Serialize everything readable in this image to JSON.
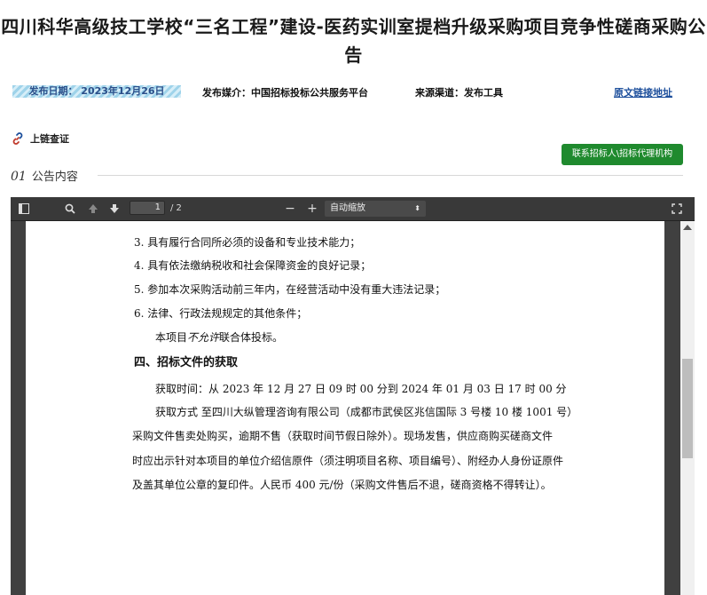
{
  "header": {
    "title": "四川科华高级技工学校“三名工程”建设-医药实训室提档升级采购项目竞争性磋商采购公告"
  },
  "meta": {
    "publish_date": "发布日期：  2023年12月26日",
    "publish_media": "发布媒介：中国招标投标公共服务平台",
    "source_channel": "来源渠道：发布工具",
    "original_link": "原文链接地址"
  },
  "chain_check": {
    "label": "上链查证",
    "icon": "chain-link-icon"
  },
  "contact_button": "联系招标人\\招标代理机构",
  "section": {
    "number": "01",
    "title": "公告内容"
  },
  "viewer": {
    "page_current": "1",
    "page_total": "/ 2",
    "zoom_minus": "−",
    "zoom_plus": "+",
    "zoom_label": "自动缩放",
    "zoom_arrow": "⬍",
    "icons": [
      "sidebar-toggle-icon",
      "search-icon",
      "previous-page-icon",
      "next-page-icon",
      "fullscreen-icon"
    ]
  },
  "document": {
    "line1": "3. 具有履行合同所必须的设备和专业技术能力；",
    "line2": "4. 具有依法缴纳税收和社会保障资金的良好记录；",
    "line3": "5. 参加本次采购活动前三年内，在经营活动中没有重大违法记录；",
    "line4": "6. 法律、行政法规规定的其他条件；",
    "line5_prefix": "本项目",
    "line5_italic": "不允许",
    "line5_suffix": "联合体投标。",
    "heading": "四、招标文件的获取",
    "time_line": "获取时间：从 2023 年 12 月 27 日  09 时 00 分到 2024 年 01 月 03 日  17 时 00 分",
    "method_line": "获取方式 至四川大纵管理咨询有限公司（成都市武侯区兆信国际 3 号楼 10 楼 1001 号）",
    "para_line1": "采购文件售卖处购买，逾期不售（获取时间节假日除外）。现场发售，供应商购买磋商文件",
    "para_line2": "时应出示针对本项目的单位介绍信原件（须注明项目名称、项目编号）、附经办人身份证原件",
    "para_line3": "及盖其单位公章的复印件。人民币 400 元/份（采购文件售后不退，磋商资格不得转让）。"
  }
}
